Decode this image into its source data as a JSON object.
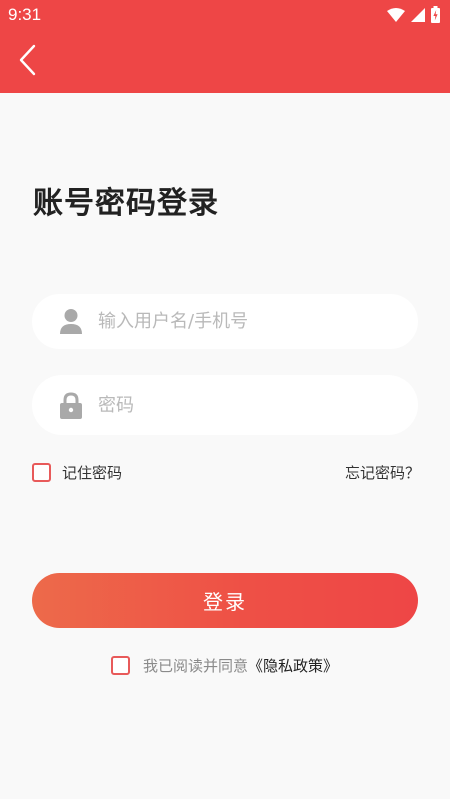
{
  "status_bar": {
    "time": "9:31"
  },
  "header": {
    "back_icon": "chevron-left-icon"
  },
  "page": {
    "title": "账号密码登录"
  },
  "form": {
    "username": {
      "placeholder": "输入用户名/手机号",
      "value": "",
      "icon": "user-icon"
    },
    "password": {
      "placeholder": "密码",
      "value": "",
      "icon": "lock-icon"
    },
    "remember_label": "记住密码",
    "remember_checked": false,
    "forgot_link": "忘记密码？",
    "login_label": "登录"
  },
  "agreement": {
    "text": "我已阅读并同意",
    "link": "《隐私政策》",
    "checked": false
  },
  "colors": {
    "brand": "#ee4646",
    "button_gradient_start": "#ed6a4a",
    "background": "#f9f9f9"
  }
}
